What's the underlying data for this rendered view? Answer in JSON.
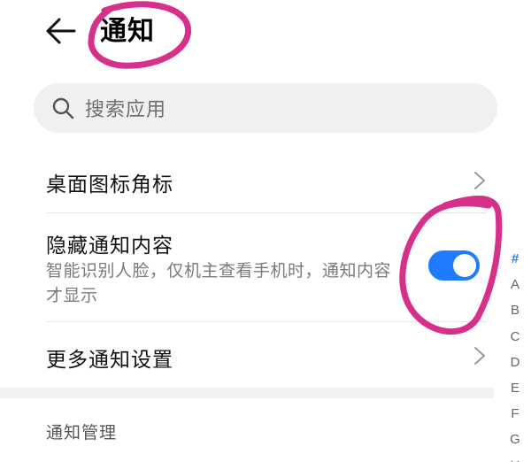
{
  "header": {
    "title": "通知",
    "back_icon": "arrow-left-icon"
  },
  "search": {
    "placeholder": "搜索应用",
    "icon": "search-icon"
  },
  "rows": [
    {
      "label": "桌面图标角标",
      "trailing": "chevron-right-icon"
    },
    {
      "label": "隐藏通知内容",
      "description": "智能识别人脸，仅机主查看手机时，通知内容才显示",
      "toggle_on": true
    },
    {
      "label": "更多通知设置",
      "trailing": "chevron-right-icon"
    }
  ],
  "section": {
    "header": "通知管理"
  },
  "alpha_index": [
    "#",
    "A",
    "B",
    "C",
    "D",
    "E",
    "F",
    "G",
    "H"
  ],
  "colors": {
    "accent": "#1f7cff",
    "annotation": "#d6308a",
    "search_bg": "#f0f0f0"
  }
}
